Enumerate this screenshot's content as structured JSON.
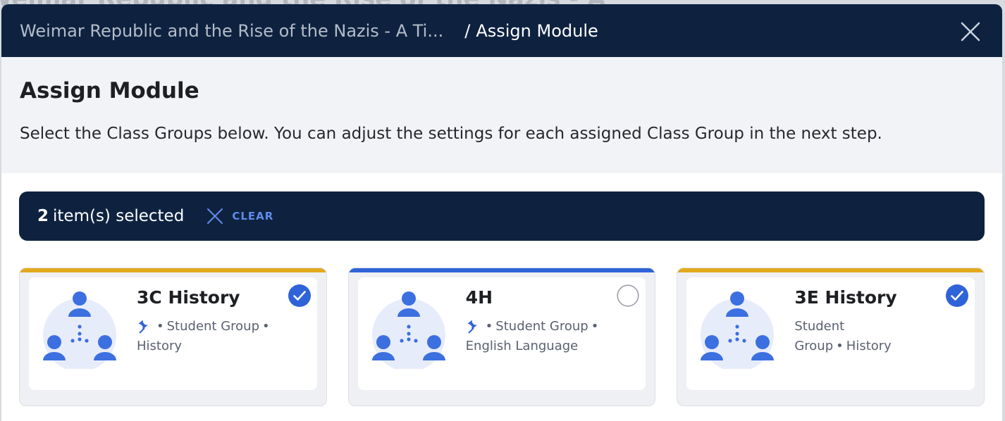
{
  "background": {
    "title": "Weimar Republic and the Rise of the Nazis - A"
  },
  "header": {
    "parent_crumb": "Weimar Republic and the Rise of the Nazis - A Ti...",
    "separator": "/",
    "current_crumb": "Assign Module",
    "close_icon": "close-icon"
  },
  "intro": {
    "title": "Assign Module",
    "description": "Select the Class Groups below. You can adjust the settings for each assigned Class Group in the next step."
  },
  "selection": {
    "count": "2",
    "text": "item(s) selected",
    "clear_label": "CLEAR",
    "clear_icon": "close-icon"
  },
  "class_groups": [
    {
      "name": "3C History",
      "pinned": true,
      "sep1": "•",
      "type": "Student Group",
      "sep2": "•",
      "subject": "History",
      "selected": true,
      "accent": "#e3a91e"
    },
    {
      "name": "4H",
      "pinned": true,
      "sep1": "•",
      "type": "Student Group",
      "sep2": "•",
      "subject": "English Language",
      "selected": false,
      "accent": "#2f63d8"
    },
    {
      "name": "3E History",
      "pinned": false,
      "type": "Student Group",
      "sep2": "•",
      "subject": "History",
      "selected": true,
      "accent": "#e3a91e"
    }
  ],
  "colors": {
    "navy": "#0e2240",
    "check_blue": "#2f63d8",
    "link_blue": "#5f8bea"
  }
}
